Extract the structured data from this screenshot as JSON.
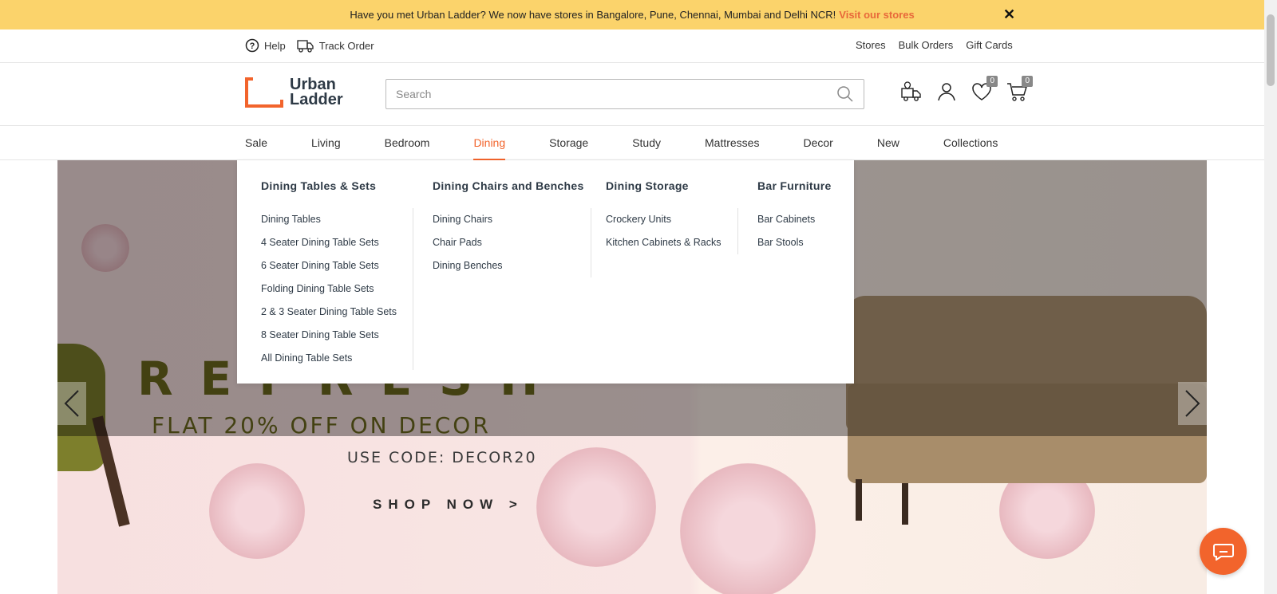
{
  "announcement": {
    "text": "Have you met Urban Ladder? We now have stores in Bangalore, Pune, Chennai, Mumbai and Delhi NCR!",
    "link": "Visit our stores",
    "close": "✕"
  },
  "utility": {
    "help": "Help",
    "track": "Track Order",
    "right": [
      "Stores",
      "Bulk Orders",
      "Gift Cards"
    ]
  },
  "logo": {
    "line1": "Urban",
    "line2": "Ladder"
  },
  "search": {
    "placeholder": "Search"
  },
  "header_icons": {
    "wishlist_count": "0",
    "cart_count": "0"
  },
  "nav": {
    "items": [
      "Sale",
      "Living",
      "Bedroom",
      "Dining",
      "Storage",
      "Study",
      "Mattresses",
      "Decor",
      "New",
      "Collections"
    ],
    "active": "Dining"
  },
  "mega_menu": {
    "columns": [
      {
        "title": "Dining Tables & Sets",
        "items": [
          "Dining Tables",
          "4 Seater Dining Table Sets",
          "6 Seater Dining Table Sets",
          "Folding Dining Table Sets",
          "2 & 3 Seater Dining Table Sets",
          "8 Seater Dining Table Sets",
          "All Dining Table Sets"
        ]
      },
      {
        "title": "Dining Chairs and Benches",
        "items": [
          "Dining Chairs",
          "Chair Pads",
          "Dining Benches"
        ]
      },
      {
        "title": "Dining Storage",
        "items": [
          "Crockery Units",
          "Kitchen Cabinets & Racks"
        ]
      },
      {
        "title": "Bar Furniture",
        "items": [
          "Bar Cabinets",
          "Bar Stools"
        ]
      }
    ]
  },
  "banner": {
    "headline": "REFRESH",
    "offer": "FLAT 20% OFF ON DECOR",
    "code": "USE CODE: DECOR20",
    "cta": "SHOP NOW >"
  },
  "colors": {
    "accent": "#f2642c",
    "announce_bg": "#fbd36b",
    "text_dark": "#2e3a46"
  }
}
